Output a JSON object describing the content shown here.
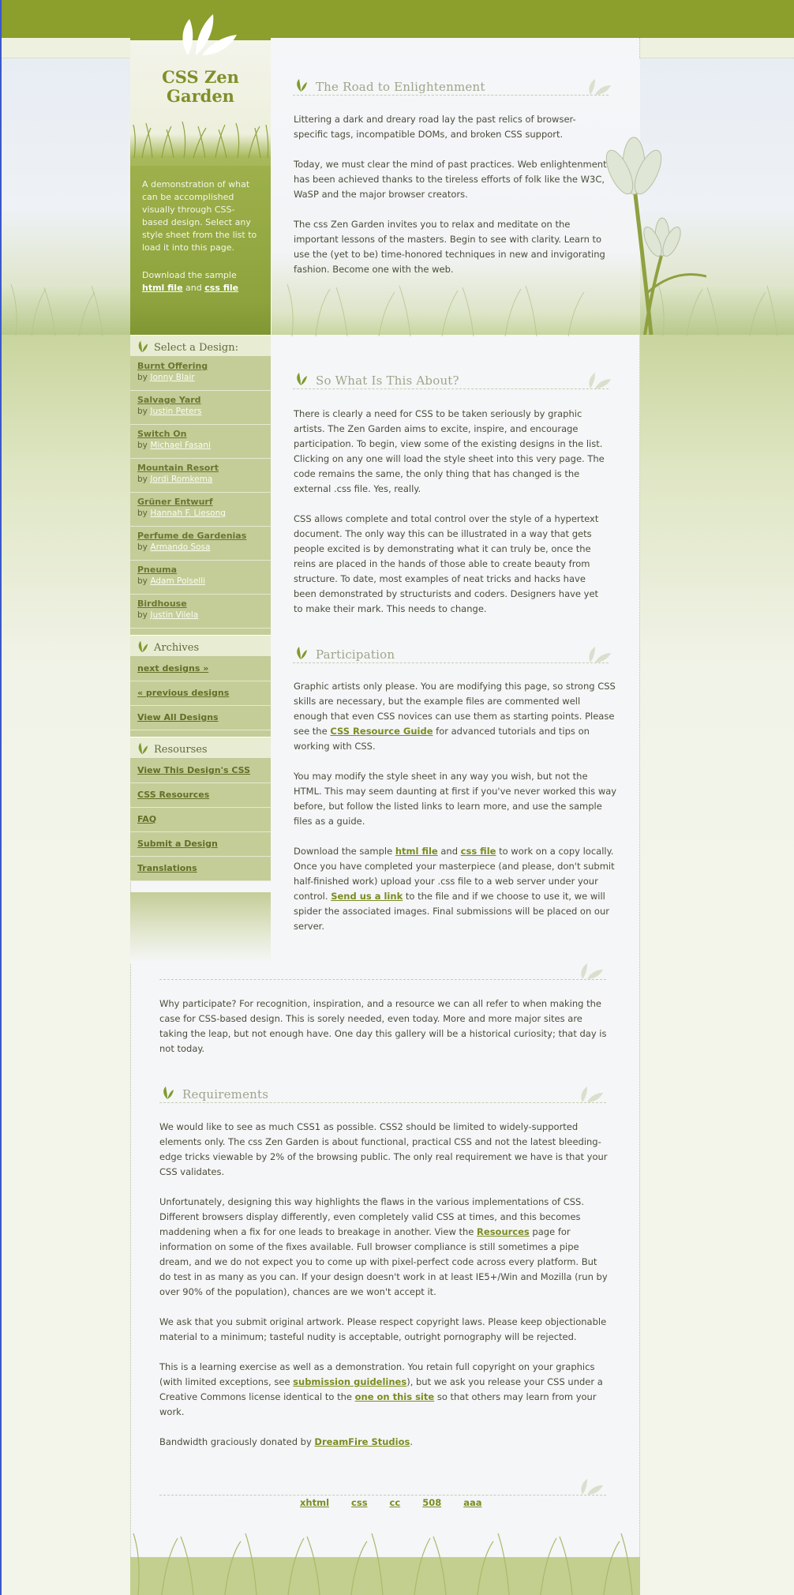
{
  "site": {
    "title_line1": "CSS Zen",
    "title_line2": "Garden"
  },
  "summary": {
    "text": "A demonstration of what can be accomplished visually through CSS-based design. Select any style sheet from the list to load it into this page.",
    "download_prefix": "Download the sample",
    "html_link": "html file",
    "and": "and",
    "css_link": "css file"
  },
  "preamble": {
    "heading": "The Road to Enlightenment",
    "p1": "Littering a dark and dreary road lay the past relics of browser-specific tags, incompatible DOMs, and broken CSS support.",
    "p2": "Today, we must clear the mind of past practices. Web enlightenment has been achieved thanks to the tireless efforts of folk like the W3C, WaSP and the major browser creators.",
    "p3": "The css Zen Garden invites you to relax and meditate on the important lessons of the masters. Begin to see with clarity. Learn to use the (yet to be) time-honored techniques in new and invigorating fashion. Become one with the web."
  },
  "explanation": {
    "heading": "So What Is This About?",
    "p1": "There is clearly a need for CSS to be taken seriously by graphic artists. The Zen Garden aims to excite, inspire, and encourage participation. To begin, view some of the existing designs in the list. Clicking on any one will load the style sheet into this very page. The code remains the same, the only thing that has changed is the external .css file. Yes, really.",
    "p2": "CSS allows complete and total control over the style of a hypertext document. The only way this can be illustrated in a way that gets people excited is by demonstrating what it can truly be, once the reins are placed in the hands of those able to create beauty from structure. To date, most examples of neat tricks and hacks have been demonstrated by structurists and coders. Designers have yet to make their mark. This needs to change."
  },
  "participation": {
    "heading": "Participation",
    "p1_a": "Graphic artists only please. You are modifying this page, so strong CSS skills are necessary, but the example files are commented well enough that even CSS novices can use them as starting points. Please see the ",
    "p1_link": "CSS Resource Guide",
    "p1_b": " for advanced tutorials and tips on working with CSS.",
    "p2": "You may modify the style sheet in any way you wish, but not the HTML. This may seem daunting at first if you've never worked this way before, but follow the listed links to learn more, and use the sample files as a guide.",
    "p3_a": "Download the sample ",
    "p3_link1": "html file",
    "p3_and": " and ",
    "p3_link2": "css file",
    "p3_b": " to work on a copy locally. Once you have completed your masterpiece (and please, don't submit half-finished work) upload your .css file to a web server under your control. ",
    "p3_link3": "Send us a link",
    "p3_c": " to the file and if we choose to use it, we will spider the associated images. Final submissions will be placed on our server."
  },
  "benefits": {
    "p1": "Why participate? For recognition, inspiration, and a resource we can all refer to when making the case for CSS-based design. This is sorely needed, even today. More and more major sites are taking the leap, but not enough have. One day this gallery will be a historical curiosity; that day is not today."
  },
  "requirements": {
    "heading": "Requirements",
    "p1": "We would like to see as much CSS1 as possible. CSS2 should be limited to widely-supported elements only. The css Zen Garden is about functional, practical CSS and not the latest bleeding-edge tricks viewable by 2% of the browsing public. The only real requirement we have is that your CSS validates.",
    "p2_a": "Unfortunately, designing this way highlights the flaws in the various implementations of CSS. Different browsers display differently, even completely valid CSS at times, and this becomes maddening when a fix for one leads to breakage in another. View the ",
    "p2_link": "Resources",
    "p2_b": " page for information on some of the fixes available. Full browser compliance is still sometimes a pipe dream, and we do not expect you to come up with pixel-perfect code across every platform. But do test in as many as you can. If your design doesn't work in at least IE5+/Win and Mozilla (run by over 90% of the population), chances are we won't accept it.",
    "p3": "We ask that you submit original artwork. Please respect copyright laws. Please keep objectionable material to a minimum; tasteful nudity is acceptable, outright pornography will be rejected.",
    "p4_a": "This is a learning exercise as well as a demonstration. You retain full copyright on your graphics (with limited exceptions, see ",
    "p4_link1": "submission guidelines",
    "p4_b": "), but we ask you release your CSS under a Creative Commons license identical to the ",
    "p4_link2": "one on this site",
    "p4_c": " so that others may learn from your work.",
    "p5_a": "Bandwidth graciously donated by ",
    "p5_link": "DreamFire Studios",
    "p5_b": "."
  },
  "sidebar": {
    "select_heading": "Select a Design:",
    "by": "by",
    "designs": [
      {
        "name": "Burnt Offering",
        "author": "Jonny Blair"
      },
      {
        "name": "Salvage Yard",
        "author": "Justin Peters"
      },
      {
        "name": "Switch On",
        "author": "Michael Fasani"
      },
      {
        "name": "Mountain Resort",
        "author": "Jordi Romkema"
      },
      {
        "name": "Grüner Entwurf",
        "author": "Hannah F. Liesong"
      },
      {
        "name": "Perfume de Gardenias",
        "author": "Armando Sosa"
      },
      {
        "name": "Pneuma",
        "author": "Adam Polselli"
      },
      {
        "name": "Birdhouse",
        "author": "Justin Vilela"
      }
    ],
    "archives_heading": "Archives",
    "archives": [
      "next designs »",
      "« previous designs",
      "View All Designs"
    ],
    "resources_heading": "Resourses",
    "resources": [
      "View This Design's CSS",
      "CSS Resources",
      "FAQ",
      "Submit a Design",
      "Translations"
    ]
  },
  "footer": {
    "links": [
      "xhtml",
      "css",
      "cc",
      "508",
      "aaa"
    ]
  },
  "colors": {
    "accent": "#8c9e2b",
    "link": "#7a8c1f",
    "sidebar": "#c4cd98"
  }
}
